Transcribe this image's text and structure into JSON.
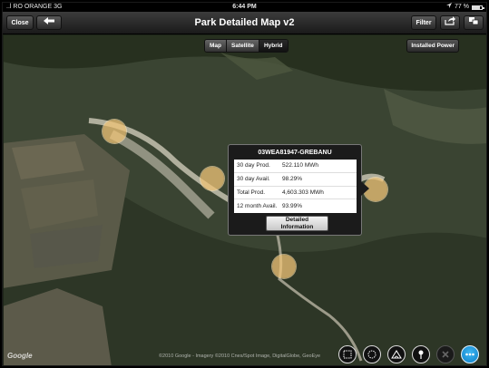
{
  "status_bar": {
    "carrier": "..l RO ORANGE  3G",
    "time": "6:44 PM",
    "battery": "77 %",
    "battery_level": 0.77
  },
  "nav": {
    "close_label": "Close",
    "title": "Park Detailed Map v2",
    "filter_label": "Filter"
  },
  "map_type": {
    "options": [
      "Map",
      "Satellite",
      "Hybrid"
    ],
    "selected": "Hybrid"
  },
  "installed_power_label": "Installed Power",
  "popup": {
    "title": "03WEA81947-GREBANU",
    "rows": [
      {
        "label": "30 day Prod.",
        "value": "522.110 MWh"
      },
      {
        "label": "30 day Avail.",
        "value": "98.29%"
      },
      {
        "label": "Total Prod.",
        "value": "4,603.303 MWh"
      },
      {
        "label": "12 month Avail.",
        "value": "93.99%"
      }
    ],
    "button_line1": "Detailed",
    "button_line2": "Information"
  },
  "map_attribution": {
    "logo": "Google",
    "copyright": "©2010 Google - Imagery ©2010 Cnes/Spot Image, DigitalGlobe, GeoEye"
  },
  "toolbar": {
    "icons": [
      "select-rect-icon",
      "select-lasso-icon",
      "measure-area-icon",
      "pin-icon",
      "clear-icon",
      "more-icon"
    ]
  },
  "colors": {
    "turbine": "#f0c478",
    "accent_blue": "#0d7fc7"
  }
}
